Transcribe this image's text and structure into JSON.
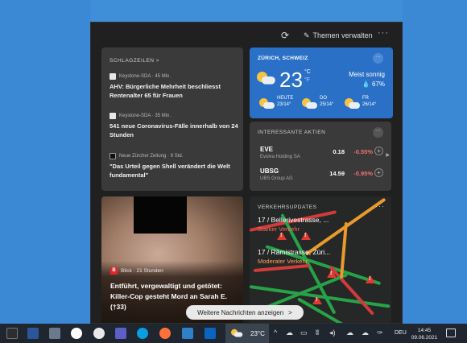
{
  "panel": {
    "manage_label": "Themen verwalten",
    "more_label": "···"
  },
  "headlines": {
    "title": "SCHLAGZEILEN >",
    "items": [
      {
        "source": "Keystone-SDA · 45 Min.",
        "title": "AHV: Bürgerliche Mehrheit beschliesst Rentenalter 65 für Frauen"
      },
      {
        "source": "Keystone-SDA · 35 Min.",
        "title": "541 neue Coronavirus-Fälle innerhalb von 24 Stunden"
      },
      {
        "source": "Neue Zürcher Zeitung · 9 Std.",
        "title": "\"Das Urteil gegen Shell verändert die Welt fundamental\""
      }
    ]
  },
  "weather": {
    "location": "ZÜRICH, SCHWEIZ",
    "temp": "23",
    "unit_c": "°C",
    "unit_f": "°F",
    "condition": "Meist sonnig",
    "humidity": "67%",
    "forecast": [
      {
        "day": "HEUTE",
        "range": "23/14°"
      },
      {
        "day": "DO",
        "range": "25/14°"
      },
      {
        "day": "FR",
        "range": "26/14°"
      }
    ]
  },
  "stocks": {
    "title": "INTERESSANTE AKTIEN",
    "items": [
      {
        "symbol": "EVE",
        "name": "Evolva Holding SA",
        "price": "0.18",
        "change": "-0.55%"
      },
      {
        "symbol": "UBSG",
        "name": "UBS Group AG",
        "price": "14.59",
        "change": "-0.95%"
      }
    ]
  },
  "story": {
    "source": "Blick · 21 Stunden",
    "logo_letter": "B",
    "title": "Entführt, vergewaltigt und getötet: Killer-Cop gesteht Mord an Sarah E. (†33)"
  },
  "traffic": {
    "title": "VERKEHRSUPDATES",
    "items": [
      {
        "route": "17 / Bellerivestrasse, ...",
        "status": "Starker Verkehr"
      },
      {
        "route": "17 / Rämistrasse, Züri...",
        "status": "Moderater Verkehr"
      }
    ]
  },
  "more_news": {
    "label": "Weitere Nachrichten anzeigen",
    "arrow": ">"
  },
  "taskbar": {
    "weather_temp": "23°C",
    "language": "DEU",
    "time": "14:45",
    "date": "09.06.2021",
    "app_icons": [
      "task-view-icon",
      "word-icon",
      "calculator-icon",
      "cortana-icon",
      "slack-icon",
      "teams-icon",
      "skype-icon",
      "firefox-icon",
      "rdp-icon",
      "outlook-icon"
    ]
  },
  "colors": {
    "weather_card": "#2a70c6",
    "card": "#3a3a3a",
    "panel": "#202020",
    "negative": "#f07070",
    "heavy_traffic": "#ff6b5a",
    "moderate_traffic": "#ffa05c",
    "desktop": "#3f8ed8"
  }
}
